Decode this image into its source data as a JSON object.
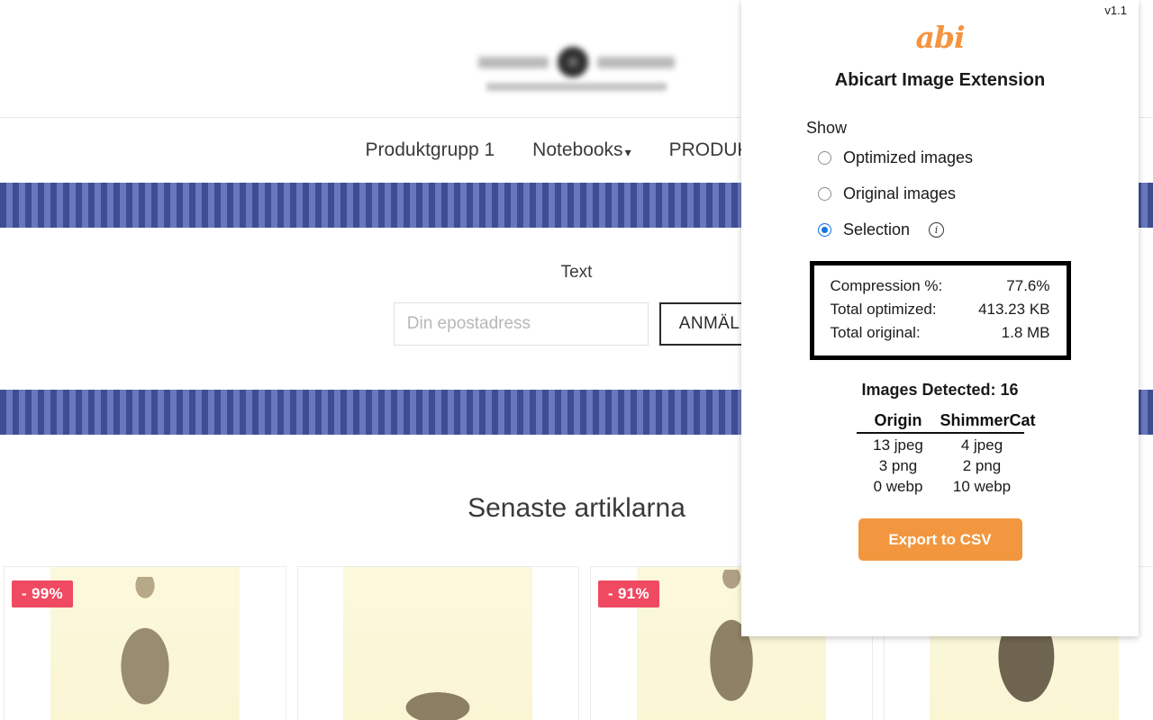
{
  "site": {
    "logo": {
      "alt": "store-logo"
    },
    "nav": [
      {
        "label": "Produktgrupp 1",
        "has_dropdown": false
      },
      {
        "label": "Notebooks",
        "has_dropdown": true
      },
      {
        "label": "PRODUKTER",
        "has_dropdown": false
      }
    ],
    "newsletter": {
      "title": "Text",
      "input_placeholder": "Din epostadress",
      "input_value": "",
      "button_label": "ANMÄL"
    },
    "products_heading": "Senaste artiklarna",
    "products": [
      {
        "badge": "- 99%"
      },
      {
        "badge": ""
      },
      {
        "badge": "- 91%"
      },
      {
        "badge": ""
      }
    ],
    "stripe_colors": {
      "dark": "#3f4d93",
      "light": "#6878bd"
    }
  },
  "panel": {
    "version": "v1.1",
    "logo_text": "abi",
    "logo_color": "#f5943f",
    "title": "Abicart Image Extension",
    "show_label": "Show",
    "radios": [
      {
        "label": "Optimized images",
        "checked": false,
        "info": false
      },
      {
        "label": "Original images",
        "checked": false,
        "info": false
      },
      {
        "label": "Selection",
        "checked": true,
        "info": true
      }
    ],
    "stats": [
      {
        "label": "Compression %:",
        "value": "77.6%"
      },
      {
        "label": "Total optimized:",
        "value": "413.23 KB"
      },
      {
        "label": "Total original:",
        "value": "1.8 MB"
      }
    ],
    "images_detected": "Images Detected: 16",
    "format_table": {
      "headers": [
        "Origin",
        "ShimmerCat"
      ],
      "rows": [
        [
          "13 jpeg",
          "4 jpeg"
        ],
        [
          "3 png",
          "2 png"
        ],
        [
          "0 webp",
          "10 webp"
        ]
      ]
    },
    "export_label": "Export to CSV",
    "accent_color": "#f2973f"
  }
}
